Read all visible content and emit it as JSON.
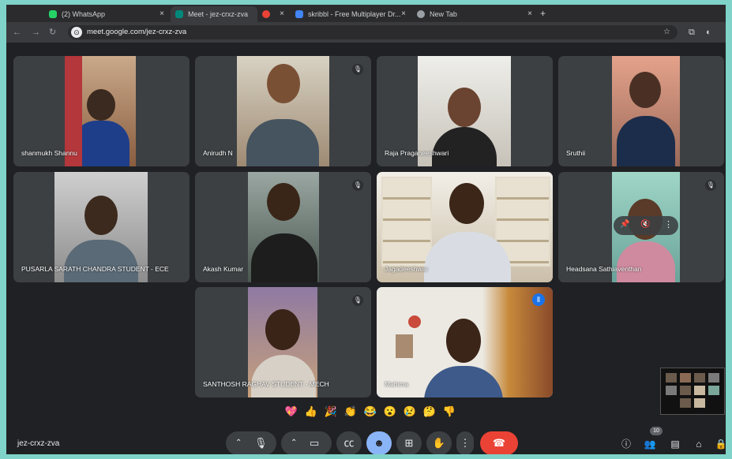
{
  "browser": {
    "tabs": [
      {
        "title": "(2) WhatsApp",
        "close": "×",
        "color": "#25d366",
        "active": false
      },
      {
        "title": "Meet - jez-crxz-zva",
        "close": "×",
        "color": "#00897b",
        "active": true
      },
      {
        "title": "",
        "close": "×",
        "color": "#ea4335",
        "active": false
      },
      {
        "title": "skribbl - Free Multiplayer Dr...",
        "close": "×",
        "color": "#4285f4",
        "active": false
      },
      {
        "title": "New Tab",
        "close": "×",
        "color": "#9aa0a6",
        "active": false
      }
    ],
    "new_tab": "+",
    "url": "meet.google.com/jez-crxz-zva"
  },
  "participants": [
    {
      "name": "shanmukh Shannu",
      "muted": false,
      "speaking": false
    },
    {
      "name": "Anirudh N",
      "muted": true,
      "speaking": false
    },
    {
      "name": "Raja Praganeeshwari",
      "muted": false,
      "speaking": false
    },
    {
      "name": "Sruthii",
      "muted": false,
      "speaking": false
    },
    {
      "name": "PUSARLA SARATH CHANDRA STUDENT - ECE",
      "muted": false,
      "speaking": false
    },
    {
      "name": "Akash Kumar",
      "muted": true,
      "speaking": false
    },
    {
      "name": "Jagadeeshwar",
      "muted": false,
      "speaking": false
    },
    {
      "name": "Headsana Sathiaventhan",
      "muted": true,
      "speaking": false
    },
    {
      "name": "SANTHOSH RAGHAV STUDENT - MECH",
      "muted": true,
      "speaking": false
    },
    {
      "name": "Mahima",
      "muted": false,
      "speaking": true
    }
  ],
  "tile_toolbar": {
    "pin": "📌",
    "mute": "🔇",
    "more": "⋮"
  },
  "reactions": [
    "💖",
    "👍",
    "🎉",
    "👏",
    "😂",
    "😮",
    "😢",
    "🤔",
    "👎"
  ],
  "meeting_code": "jez-crxz-zva",
  "participant_count": "10",
  "accent_color": "#8ab4f8",
  "end_call_color": "#ea4335"
}
